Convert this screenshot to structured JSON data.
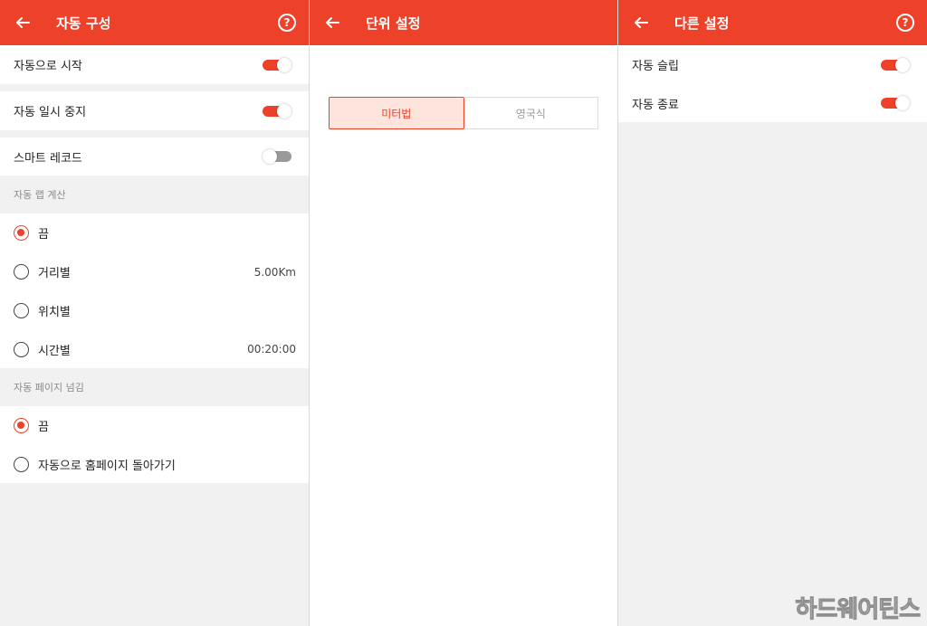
{
  "colors": {
    "accent": "#ee4129",
    "background": "#f1f1f1"
  },
  "auto_config": {
    "title": "자동 구성",
    "start_auto": {
      "label": "자동으로 시작",
      "on": true
    },
    "auto_pause": {
      "label": "자동 일시 중지",
      "on": true
    },
    "smart_record": {
      "label": "스마트 레코드",
      "on": false
    },
    "auto_lap": {
      "heading": "자동 랩 계산",
      "options": [
        {
          "label": "끔",
          "value": "",
          "selected": true
        },
        {
          "label": "거리별",
          "value": "5.00Km",
          "selected": false
        },
        {
          "label": "위치별",
          "value": "",
          "selected": false
        },
        {
          "label": "시간별",
          "value": "00:20:00",
          "selected": false
        }
      ]
    },
    "auto_page": {
      "heading": "자동 페이지 넘김",
      "options": [
        {
          "label": "끔",
          "selected": true
        },
        {
          "label": "자동으로 홈페이지 돌아가기",
          "selected": false
        }
      ]
    }
  },
  "unit_settings": {
    "title": "단위 설정",
    "options": [
      "미터법",
      "영국식"
    ],
    "selected": "미터법"
  },
  "other_settings": {
    "title": "다른 설정",
    "auto_sleep": {
      "label": "자동 슬립",
      "on": true
    },
    "auto_off": {
      "label": "자동 종료",
      "on": true
    }
  },
  "icons": {
    "back": "arrow-left-icon",
    "help": "question-circle-icon"
  },
  "help_glyph": "?",
  "watermark": "하드웨어틴스"
}
